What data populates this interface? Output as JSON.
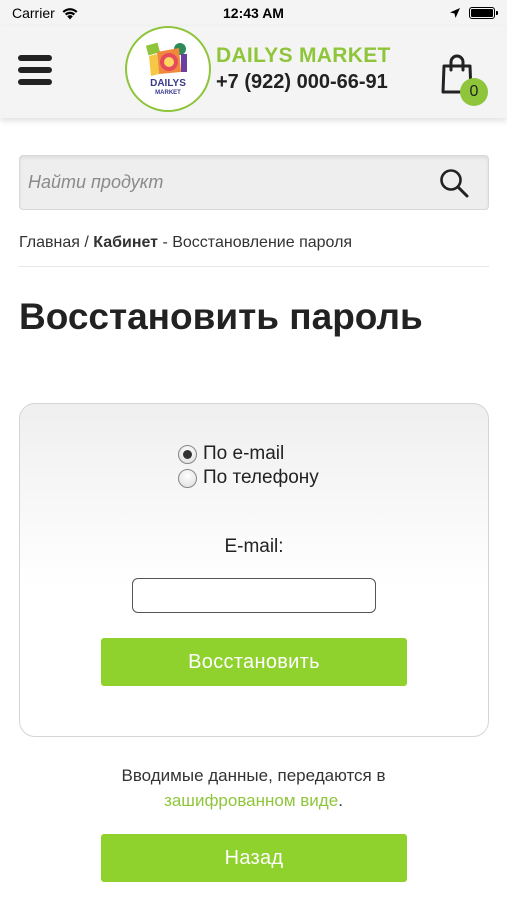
{
  "status_bar": {
    "carrier": "Carrier",
    "time": "12:43 AM"
  },
  "header": {
    "brand_name": "DAILYS MARKET",
    "phone": "+7 (922) 000-66-91",
    "cart_count": "0",
    "logo_text_top": "DAILYS",
    "logo_text_bottom": "MARKET"
  },
  "search": {
    "placeholder": "Найти продукт",
    "value": ""
  },
  "breadcrumb": {
    "home": "Главная",
    "sep1": " / ",
    "cabinet": "Кабинет",
    "sep2": " - ",
    "current": "Восстановление пароля"
  },
  "page_title": "Восстановить пароль",
  "form": {
    "options": [
      {
        "label": "По e-mail",
        "checked": true
      },
      {
        "label": "По телефону",
        "checked": false
      }
    ],
    "email_label": "E-mail:",
    "email_value": "",
    "submit_label": "Восстановить"
  },
  "info": {
    "text_line1": "Вводимые данные, передаются в",
    "link_text": "зашифрованном виде",
    "text_end": "."
  },
  "back_label": "Назад",
  "colors": {
    "accent": "#8fc53a",
    "button": "#8fd12d"
  }
}
